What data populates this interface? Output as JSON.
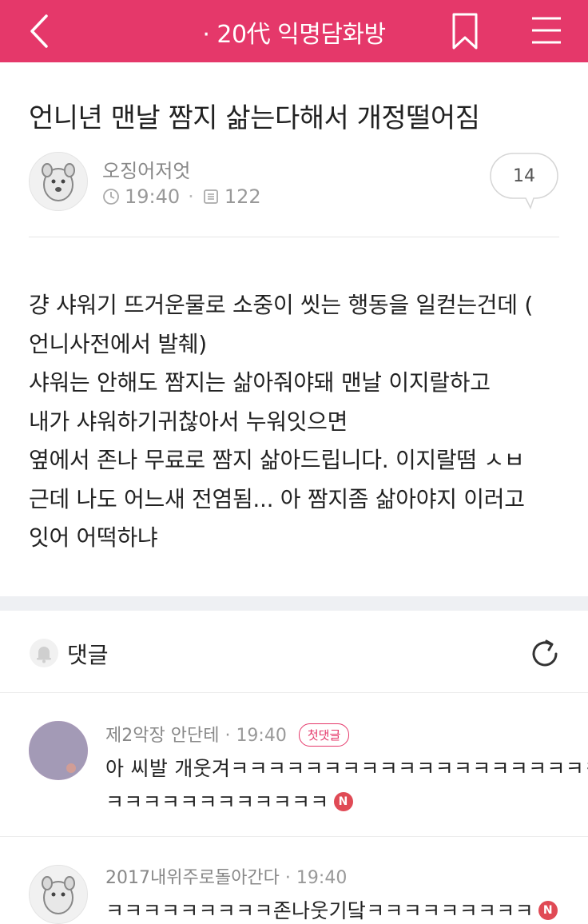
{
  "header": {
    "back_icon": "chevron-left-icon",
    "title": "· 20代 익명담화방",
    "bookmark_icon": "bookmark-icon",
    "menu_icon": "hamburger-menu-icon",
    "background": "#e5386a"
  },
  "post": {
    "title": "언니년 맨날 짬지 삶는다해서 개정떨어짐",
    "author": "오징어저엇",
    "time": "19:40",
    "views": "122",
    "comment_count": "14",
    "body_lines": [
      "걍 샤워기 뜨거운물로 소중이 씻는 행동을 일컫는건데 (",
      "언니사전에서 발췌)",
      "샤워는 안해도 짬지는 삶아줘야돼 맨날 이지랄하고",
      "내가 샤워하기귀찮아서 누워잇으면",
      "옆에서 존나 무료로 짬지 삶아드립니다. 이지랄떰 ㅅㅂ",
      "근데 나도 어느새 전염됨... 아 짬지좀 삶아야지 이러고",
      "잇어 어떡하냐"
    ]
  },
  "comments_section": {
    "label": "댓글",
    "bell_icon": "bell-icon",
    "refresh_icon": "refresh-icon"
  },
  "comments": [
    {
      "name": "제2악장 안단테",
      "time": "19:40",
      "badge": "첫댓글",
      "lines": [
        "아 씨발 개웃겨ㅋㅋㅋㅋㅋㅋㅋㅋㅋㅋㅋㅋㅋㅋㅋㅋㅋㅋㅋㅋ",
        "ㅋㅋㅋㅋㅋㅋㅋㅋㅋㅋㅋㅋ"
      ],
      "new_badge": "N"
    },
    {
      "name": "2017내위주로돌아간다",
      "time": "19:40",
      "lines": [
        "ㅋㅋㅋㅋㅋㅋㅋㅋㅋ존나웃기닼ㅋㅋㅋㅋㅋㅋㅋㅋㅋ"
      ],
      "new_badge": "N"
    }
  ]
}
